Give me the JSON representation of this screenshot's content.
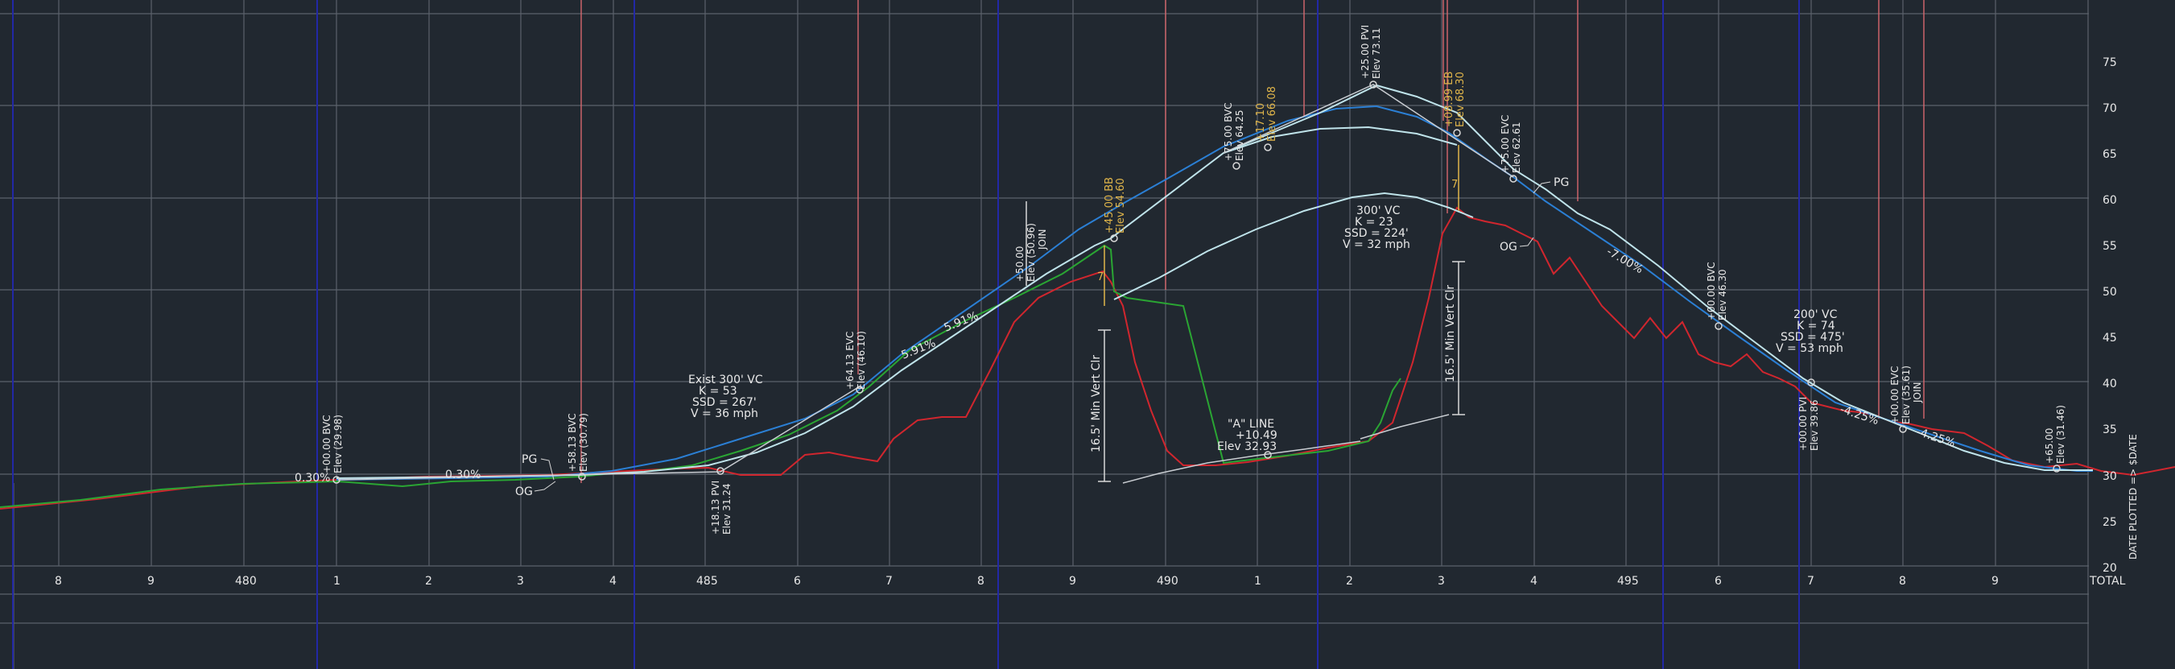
{
  "colors": {
    "background": "#212830",
    "grid": "#5b626b",
    "existing_ground": "#d0262e",
    "proposed_grade": "#bfe3ea",
    "profile_blue": "#2b7fd4",
    "profile_green": "#2aa533",
    "annotation_yellow": "#e1b64a",
    "station_red": "#e06a70",
    "white": "#e8e8e8"
  },
  "elevation_axis": {
    "ticks": [
      "75",
      "70",
      "65",
      "60",
      "55",
      "50",
      "45",
      "40",
      "35",
      "30",
      "25",
      "20"
    ],
    "total_label": "TOTAL",
    "date_label": "DATE PLOTTED => $DATE"
  },
  "station_axis": {
    "ticks": [
      "8",
      "9",
      "480",
      "1",
      "2",
      "3",
      "4",
      "485",
      "6",
      "7",
      "8",
      "9",
      "490",
      "1",
      "2",
      "3",
      "4",
      "495",
      "6",
      "7",
      "8",
      "9"
    ]
  },
  "grades": {
    "g1": "0.30%",
    "g2": "0.30%",
    "g3": "5.91%",
    "g4": "5.91%",
    "g5": "-7.00%",
    "g6": "-4.25%",
    "g7": "-4.25%"
  },
  "callouts": {
    "pg_left": "PG",
    "og_left": "OG",
    "pg_right": "PG",
    "og_right": "OG"
  },
  "annotations": {
    "bvc_1": "+00.00 BVC",
    "bvc_1_elev": "Elev (29.98)",
    "bvc_2": "+58.13 BVC",
    "bvc_2_elev": "Elev (30.79)",
    "pvi_1": "+18.13 PVI",
    "pvi_1_elev": "Elev 31.24",
    "evc_1": "+64.13 EVC",
    "evc_1_elev": "Elev (46.10)",
    "exist_vc_title": "Exist 300' VC",
    "exist_vc_k": "K = 53",
    "exist_vc_ssd": "SSD = 267'",
    "exist_vc_v": "V = 36 mph",
    "sta_50": "+50.00",
    "sta_50_elev": "Elev (50.96)",
    "sta_50_tag": "JOIN",
    "y_sta_1": "+45.00 BB",
    "y_sta_1_elev": "Elev 54.60",
    "bvc_3": "+75.00 BVC",
    "bvc_3_elev": "Elev 64.25",
    "y_sta_2": "+17.10",
    "y_sta_2_elev": "Elev 66.08",
    "pvi_top": "+25.00 PVI",
    "pvi_top_elev": "Elev 73.11",
    "y_sta_3": "+08.99 EB",
    "y_sta_3_elev": "Elev 68.30",
    "evc_3": "+75.00 EVC",
    "evc_3_elev": "Elev 62.61",
    "crest_vc_title": "300' VC",
    "crest_vc_k": "K = 23",
    "crest_vc_ssd": "SSD = 224'",
    "crest_vc_v": "V = 32 mph",
    "min_clr_left": "16.5' Min Vert Clr",
    "min_clr_right": "16.5' Min Vert Clr",
    "a_line": "\"A\" LINE",
    "a_line_sta": "+10.49",
    "a_line_elev": "Elev 32.93",
    "bvc_4": "+00.00 BVC",
    "bvc_4_elev": "Elev 46.30",
    "vc_200_title": "200' VC",
    "vc_200_k": "K = 74",
    "vc_200_ssd": "SSD = 475'",
    "vc_200_v": "V = 53 mph",
    "pvi_2": "+00.00 PVI",
    "pvi_2_elev": "Elev 39.86",
    "evc_4": "+00.00 EVC",
    "evc_4_elev": "Elev (35.61)",
    "evc_4_tag": "JOIN",
    "sta_end": "+65.00",
    "sta_end_elev": "Elev (31.46)",
    "small_seven_1": "7",
    "small_seven_2": "7"
  }
}
